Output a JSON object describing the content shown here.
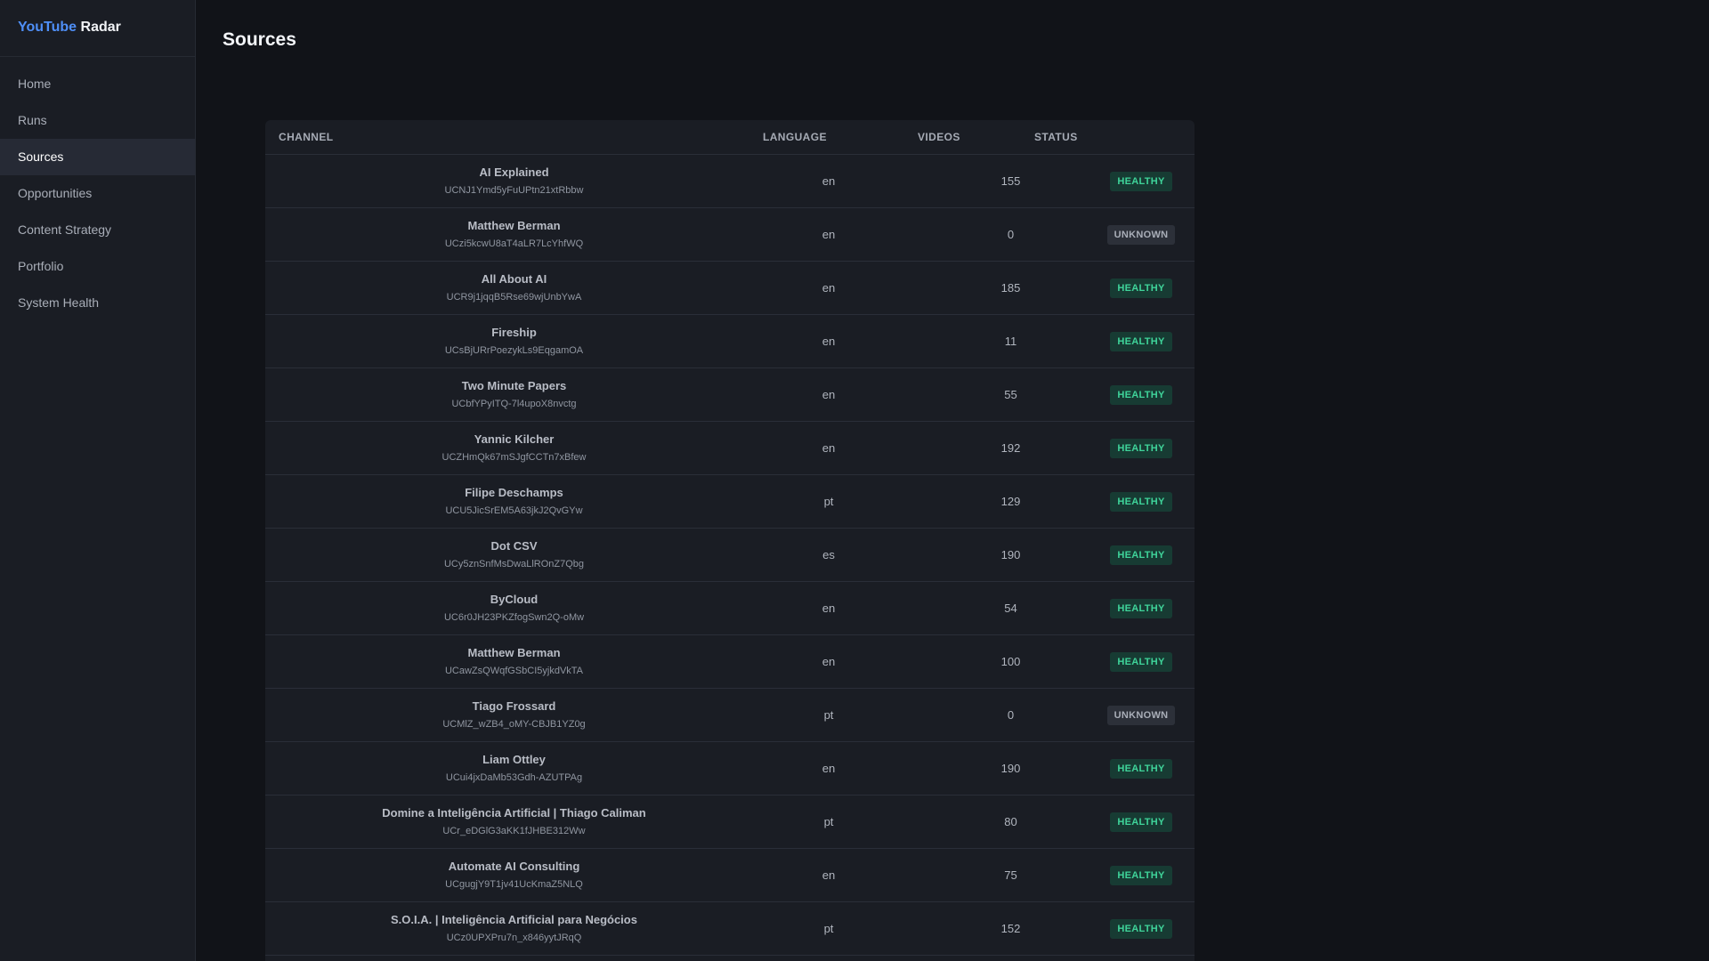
{
  "brand": {
    "part1": "YouTube",
    "part2": "Radar"
  },
  "nav": [
    {
      "label": "Home",
      "active": false
    },
    {
      "label": "Runs",
      "active": false
    },
    {
      "label": "Sources",
      "active": true
    },
    {
      "label": "Opportunities",
      "active": false
    },
    {
      "label": "Content Strategy",
      "active": false
    },
    {
      "label": "Portfolio",
      "active": false
    },
    {
      "label": "System Health",
      "active": false
    }
  ],
  "page": {
    "title": "Sources"
  },
  "table": {
    "headers": {
      "channel": "CHANNEL",
      "language": "LANGUAGE",
      "videos": "VIDEOS",
      "status": "STATUS"
    },
    "rows": [
      {
        "name": "AI Explained",
        "id": "UCNJ1Ymd5yFuUPtn21xtRbbw",
        "language": "en",
        "videos": "155",
        "status": "HEALTHY"
      },
      {
        "name": "Matthew Berman",
        "id": "UCzi5kcwU8aT4aLR7LcYhfWQ",
        "language": "en",
        "videos": "0",
        "status": "UNKNOWN"
      },
      {
        "name": "All About AI",
        "id": "UCR9j1jqqB5Rse69wjUnbYwA",
        "language": "en",
        "videos": "185",
        "status": "HEALTHY"
      },
      {
        "name": "Fireship",
        "id": "UCsBjURrPoezykLs9EqgamOA",
        "language": "en",
        "videos": "11",
        "status": "HEALTHY"
      },
      {
        "name": "Two Minute Papers",
        "id": "UCbfYPyITQ-7l4upoX8nvctg",
        "language": "en",
        "videos": "55",
        "status": "HEALTHY"
      },
      {
        "name": "Yannic Kilcher",
        "id": "UCZHmQk67mSJgfCCTn7xBfew",
        "language": "en",
        "videos": "192",
        "status": "HEALTHY"
      },
      {
        "name": "Filipe Deschamps",
        "id": "UCU5JicSrEM5A63jkJ2QvGYw",
        "language": "pt",
        "videos": "129",
        "status": "HEALTHY"
      },
      {
        "name": "Dot CSV",
        "id": "UCy5znSnfMsDwaLlROnZ7Qbg",
        "language": "es",
        "videos": "190",
        "status": "HEALTHY"
      },
      {
        "name": "ByCloud",
        "id": "UC6r0JH23PKZfogSwn2Q-oMw",
        "language": "en",
        "videos": "54",
        "status": "HEALTHY"
      },
      {
        "name": "Matthew Berman",
        "id": "UCawZsQWqfGSbCI5yjkdVkTA",
        "language": "en",
        "videos": "100",
        "status": "HEALTHY"
      },
      {
        "name": "Tiago Frossard",
        "id": "UCMlZ_wZB4_oMY-CBJB1YZ0g",
        "language": "pt",
        "videos": "0",
        "status": "UNKNOWN"
      },
      {
        "name": "Liam Ottley",
        "id": "UCui4jxDaMb53Gdh-AZUTPAg",
        "language": "en",
        "videos": "190",
        "status": "HEALTHY"
      },
      {
        "name": "Domine a Inteligência Artificial | Thiago Caliman",
        "id": "UCr_eDGlG3aKK1fJHBE312Ww",
        "language": "pt",
        "videos": "80",
        "status": "HEALTHY"
      },
      {
        "name": "Automate AI Consulting",
        "id": "UCgugjY9T1jv41UcKmaZ5NLQ",
        "language": "en",
        "videos": "75",
        "status": "HEALTHY"
      },
      {
        "name": "S.O.I.A. | Inteligência Artificial para Negócios",
        "id": "UCz0UPXPru7n_x846yytJRqQ",
        "language": "pt",
        "videos": "152",
        "status": "HEALTHY"
      }
    ]
  },
  "colors": {
    "brand_accent": "#4f8ff7",
    "healthy_bg": "#173b33",
    "healthy_fg": "#3fd49a",
    "unknown_bg": "#2c3039",
    "unknown_fg": "#a9aeb8"
  }
}
